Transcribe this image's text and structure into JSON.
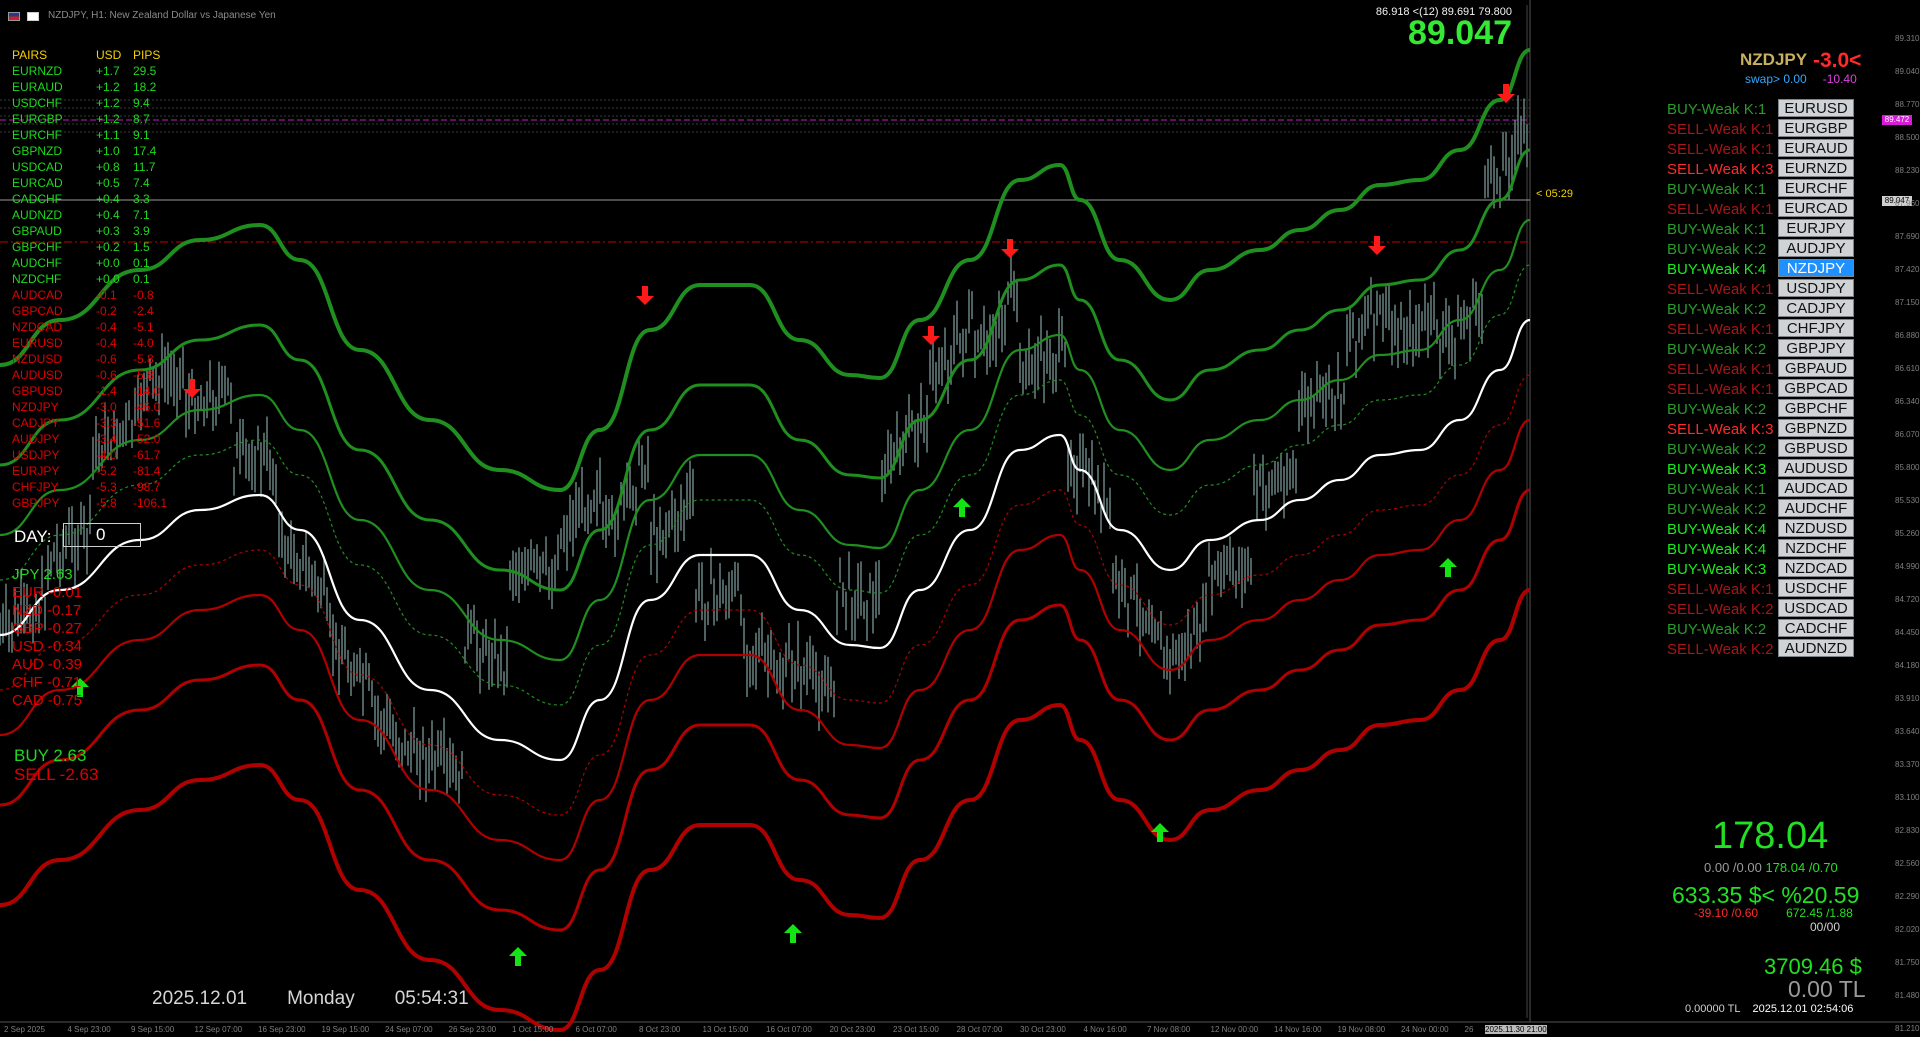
{
  "window": {
    "title": "NZDJPY, H1:  New Zealand Dollar vs Japanese Yen"
  },
  "pairs_table": {
    "headers": [
      "PAIRS",
      "USD",
      "PIPS"
    ],
    "rows": [
      {
        "pair": "EURNZD",
        "usd": "+1.7",
        "pips": "29.5",
        "trend": "pos"
      },
      {
        "pair": "EURAUD",
        "usd": "+1.2",
        "pips": "18.2",
        "trend": "pos"
      },
      {
        "pair": "USDCHF",
        "usd": "+1.2",
        "pips": "9.4",
        "trend": "pos"
      },
      {
        "pair": "EURGBP",
        "usd": "+1.2",
        "pips": "8.7",
        "trend": "pos"
      },
      {
        "pair": "EURCHF",
        "usd": "+1.1",
        "pips": "9.1",
        "trend": "pos"
      },
      {
        "pair": "GBPNZD",
        "usd": "+1.0",
        "pips": "17.4",
        "trend": "pos"
      },
      {
        "pair": "USDCAD",
        "usd": "+0.8",
        "pips": "11.7",
        "trend": "pos"
      },
      {
        "pair": "EURCAD",
        "usd": "+0.5",
        "pips": "7.4",
        "trend": "pos"
      },
      {
        "pair": "CADCHF",
        "usd": "+0.4",
        "pips": "3.3",
        "trend": "pos"
      },
      {
        "pair": "AUDNZD",
        "usd": "+0.4",
        "pips": "7.1",
        "trend": "pos"
      },
      {
        "pair": "GBPAUD",
        "usd": "+0.3",
        "pips": "3.9",
        "trend": "pos"
      },
      {
        "pair": "GBPCHF",
        "usd": "+0.2",
        "pips": "1.5",
        "trend": "pos"
      },
      {
        "pair": "AUDCHF",
        "usd": "+0.0",
        "pips": "0.1",
        "trend": "pos"
      },
      {
        "pair": "NZDCHF",
        "usd": "+0.0",
        "pips": "0.1",
        "trend": "pos"
      },
      {
        "pair": "AUDCAD",
        "usd": "-0.1",
        "pips": "-0.8",
        "trend": "neg"
      },
      {
        "pair": "GBPCAD",
        "usd": "-0.2",
        "pips": "-2.4",
        "trend": "neg"
      },
      {
        "pair": "NZDCAD",
        "usd": "-0.4",
        "pips": "-5.1",
        "trend": "neg"
      },
      {
        "pair": "EURUSD",
        "usd": "-0.4",
        "pips": "-4.0",
        "trend": "neg"
      },
      {
        "pair": "NZDUSD",
        "usd": "-0.6",
        "pips": "-5.8",
        "trend": "neg"
      },
      {
        "pair": "AUDUSD",
        "usd": "-0.6",
        "pips": "-5.8",
        "trend": "neg"
      },
      {
        "pair": "GBPUSD",
        "usd": "-1.4",
        "pips": "-14.0",
        "trend": "neg"
      },
      {
        "pair": "NZDJPY",
        "usd": "-3.0",
        "pips": "-46.0",
        "trend": "neg"
      },
      {
        "pair": "CADJPY",
        "usd": "-3.3",
        "pips": "-51.6",
        "trend": "neg"
      },
      {
        "pair": "AUDJPY",
        "usd": "-3.4",
        "pips": "-52.0",
        "trend": "neg"
      },
      {
        "pair": "USDJPY",
        "usd": "-4.0",
        "pips": "-61.7",
        "trend": "neg"
      },
      {
        "pair": "EURJPY",
        "usd": "-5.2",
        "pips": "-81.4",
        "trend": "neg"
      },
      {
        "pair": "CHFJPY",
        "usd": "-5.3",
        "pips": "-98.7",
        "trend": "neg"
      },
      {
        "pair": "GBPJPY",
        "usd": "-5.8",
        "pips": "-106.1",
        "trend": "neg"
      }
    ]
  },
  "day": {
    "label": "DAY:",
    "value": "0"
  },
  "currency_strength": [
    {
      "text": "JPY  2.63",
      "trend": "pos"
    },
    {
      "text": "EUR  -0.01",
      "trend": "neg"
    },
    {
      "text": "NZD  -0.17",
      "trend": "neg"
    },
    {
      "text": "GBP  -0.27",
      "trend": "neg"
    },
    {
      "text": "USD  -0.34",
      "trend": "neg"
    },
    {
      "text": "AUD  -0.39",
      "trend": "neg"
    },
    {
      "text": "CHF  -0.71",
      "trend": "neg"
    },
    {
      "text": "CAD  -0.75",
      "trend": "neg"
    }
  ],
  "buy_sell": {
    "buy": "BUY  2.63",
    "sell": "SELL -2.63"
  },
  "datetime": {
    "date": "2025.12.01",
    "weekday": "Monday",
    "time": "05:54:31"
  },
  "price_panel": {
    "ohlc": "86.918 <(12) 89.691 79.800",
    "price": "89.047",
    "symbol": "NZDJPY",
    "change": "-3.0<",
    "swap_label": "swap> 0.00",
    "swap_value": "-10.40"
  },
  "signals": [
    {
      "text": "BUY-Weak K:1",
      "kind": "buy-weak",
      "pair": "EURUSD"
    },
    {
      "text": "SELL-Weak K:1",
      "kind": "sell-weak",
      "pair": "EURGBP"
    },
    {
      "text": "SELL-Weak K:1",
      "kind": "sell-weak",
      "pair": "EURAUD"
    },
    {
      "text": "SELL-Weak K:3",
      "kind": "sell-strong",
      "pair": "EURNZD"
    },
    {
      "text": "BUY-Weak K:1",
      "kind": "buy-weak",
      "pair": "EURCHF"
    },
    {
      "text": "SELL-Weak K:1",
      "kind": "sell-weak",
      "pair": "EURCAD"
    },
    {
      "text": "BUY-Weak K:1",
      "kind": "buy-weak",
      "pair": "EURJPY"
    },
    {
      "text": "BUY-Weak K:2",
      "kind": "buy-weak",
      "pair": "AUDJPY"
    },
    {
      "text": "BUY-Weak K:4",
      "kind": "buy-strong",
      "pair": "NZDJPY",
      "active": true
    },
    {
      "text": "SELL-Weak K:1",
      "kind": "sell-weak",
      "pair": "USDJPY"
    },
    {
      "text": "BUY-Weak K:2",
      "kind": "buy-weak",
      "pair": "CADJPY"
    },
    {
      "text": "SELL-Weak K:1",
      "kind": "sell-weak",
      "pair": "CHFJPY"
    },
    {
      "text": "BUY-Weak K:2",
      "kind": "buy-weak",
      "pair": "GBPJPY"
    },
    {
      "text": "SELL-Weak K:1",
      "kind": "sell-weak",
      "pair": "GBPAUD"
    },
    {
      "text": "SELL-Weak K:1",
      "kind": "sell-weak",
      "pair": "GBPCAD"
    },
    {
      "text": "BUY-Weak K:2",
      "kind": "buy-weak",
      "pair": "GBPCHF"
    },
    {
      "text": "SELL-Weak K:3",
      "kind": "sell-strong",
      "pair": "GBPNZD"
    },
    {
      "text": "BUY-Weak K:2",
      "kind": "buy-weak",
      "pair": "GBPUSD"
    },
    {
      "text": "BUY-Weak K:3",
      "kind": "buy-strong",
      "pair": "AUDUSD"
    },
    {
      "text": "BUY-Weak K:1",
      "kind": "buy-weak",
      "pair": "AUDCAD"
    },
    {
      "text": "BUY-Weak K:2",
      "kind": "buy-weak",
      "pair": "AUDCHF"
    },
    {
      "text": "BUY-Weak K:4",
      "kind": "buy-strong",
      "pair": "NZDUSD"
    },
    {
      "text": "BUY-Weak K:4",
      "kind": "buy-strong",
      "pair": "NZDCHF"
    },
    {
      "text": "BUY-Weak K:3",
      "kind": "buy-strong",
      "pair": "NZDCAD"
    },
    {
      "text": "SELL-Weak K:1",
      "kind": "sell-weak",
      "pair": "USDCHF"
    },
    {
      "text": "SELL-Weak K:2",
      "kind": "sell-weak",
      "pair": "USDCAD"
    },
    {
      "text": "BUY-Weak K:2",
      "kind": "buy-weak",
      "pair": "CADCHF"
    },
    {
      "text": "SELL-Weak K:2",
      "kind": "sell-weak",
      "pair": "AUDNZD"
    }
  ],
  "account": {
    "profit": "178.04",
    "profit_sub_a": "0.00 /0.00",
    "profit_sub_b": "178.04 /0.70",
    "equity": "633.35 $< %20.59",
    "equity_sub_left": "-39.10 /0.60",
    "equity_sub_right": "672.45 /1.88",
    "equity_sub_2": "00/00",
    "balance": "3709.46 $",
    "balance_tl": "0.00 TL",
    "footer_tl": "0.00000 TL",
    "footer_datetime": "2025.12.01 02:54:06"
  },
  "timer": "< 05:29",
  "price_tags": {
    "magenta": "89.472",
    "current": "89.047"
  },
  "y_axis": [
    "89.310",
    "89.040",
    "88.770",
    "88.500",
    "88.230",
    "87.960",
    "87.690",
    "87.420",
    "87.150",
    "86.880",
    "86.610",
    "86.340",
    "86.070",
    "85.800",
    "85.530",
    "85.260",
    "84.990",
    "84.720",
    "84.450",
    "84.180",
    "83.910",
    "83.640",
    "83.370",
    "83.100",
    "82.830",
    "82.560",
    "82.290",
    "82.020",
    "81.750",
    "81.480",
    "81.210"
  ],
  "x_axis": [
    "2 Sep 2025",
    "4 Sep 23:00",
    "9 Sep 15:00",
    "12 Sep 07:00",
    "16 Sep 23:00",
    "19 Sep 15:00",
    "24 Sep 07:00",
    "26 Sep 23:00",
    "1 Oct 15:00",
    "6 Oct 07:00",
    "8 Oct 23:00",
    "13 Oct 15:00",
    "16 Oct 07:00",
    "20 Oct 23:00",
    "23 Oct 15:00",
    "28 Oct 07:00",
    "30 Oct 23:00",
    "4 Nov 16:00",
    "7 Nov 08:00",
    "12 Nov 00:00",
    "14 Nov 16:00",
    "19 Nov 08:00",
    "24 Nov 00:00",
    "26",
    "2025.11.30 21:00"
  ],
  "colors": {
    "green_band": "#1f8f1f",
    "red_band": "#b00000",
    "mid_line": "#ffffff",
    "candles": "#6f8c8c",
    "buy_arrow": "#14e414",
    "sell_arrow": "#ff1a1a"
  }
}
